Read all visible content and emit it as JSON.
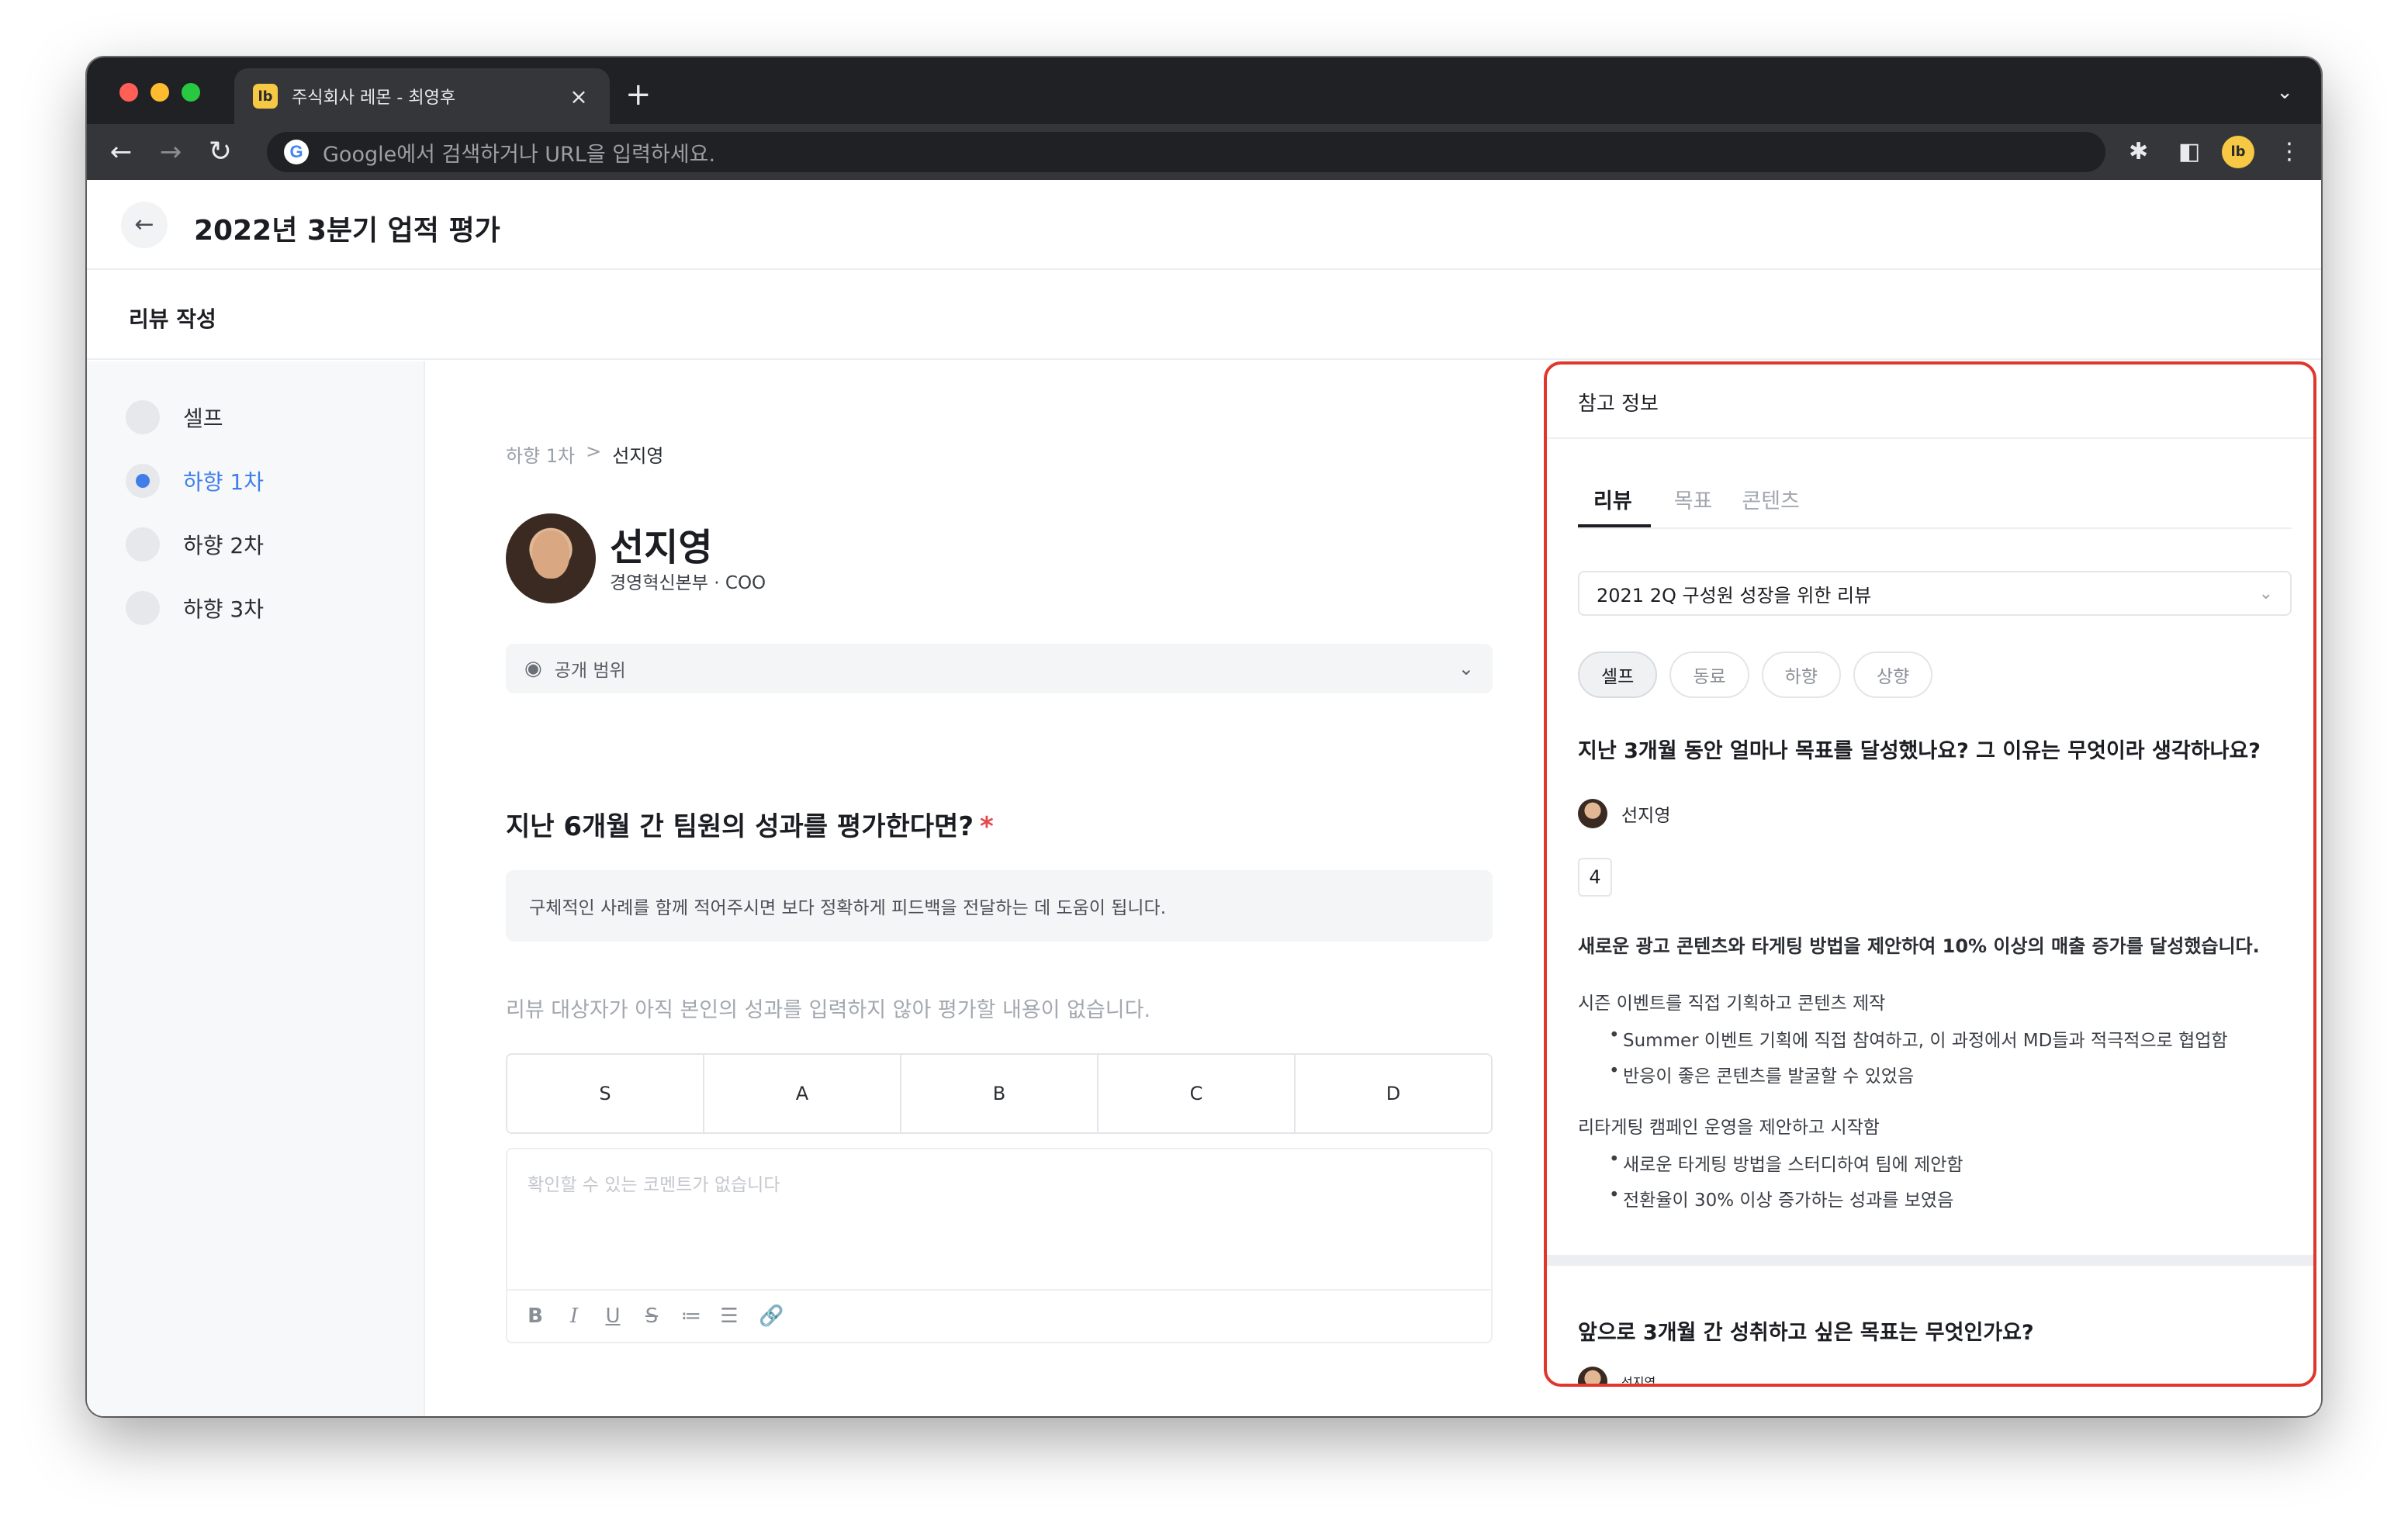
{
  "browser": {
    "tab_title": "주식회사 레몬 - 최영후",
    "tab_favicon": "lb",
    "profile_initials": "lb",
    "omnibox_placeholder": "Google에서 검색하거나 URL을 입력하세요.",
    "new_tab": "+",
    "close": "×"
  },
  "header": {
    "title": "2022년 3분기 업적 평가",
    "subtitle": "리뷰 작성"
  },
  "sidebar": {
    "steps": [
      {
        "label": "셀프"
      },
      {
        "label": "하향 1차"
      },
      {
        "label": "하향 2차"
      },
      {
        "label": "하향 3차"
      }
    ],
    "active_index": 1
  },
  "main": {
    "breadcrumb": {
      "parent": "하향 1차",
      "separator": ">",
      "current": "선지영"
    },
    "person": {
      "name": "선지영",
      "role": "경영혁신본부 · COO"
    },
    "scope_label": "공개 범위",
    "question": "지난 6개월 간 팀원의 성과를 평가한다면?",
    "required_mark": "*",
    "hint": "구체적인 사례를 함께 적어주시면 보다 정확하게 피드백을 전달하는 데 도움이 됩니다.",
    "empty_notice": "리뷰 대상자가 아직 본인의 성과를 입력하지 않아 평가할 내용이 없습니다.",
    "grades": [
      "S",
      "A",
      "B",
      "C",
      "D"
    ],
    "comment_placeholder": "확인할 수 있는 코멘트가 없습니다"
  },
  "panel": {
    "title": "참고 정보",
    "tabs": [
      "리뷰",
      "목표",
      "콘텐츠"
    ],
    "active_tab": 0,
    "select_value": "2021 2Q 구성원 성장을 위한 리뷰",
    "chips": [
      "셀프",
      "동료",
      "하향",
      "상향"
    ],
    "active_chip": 0,
    "question1": "지난 3개월 동안 얼마나 목표를 달성했나요? 그 이유는 무엇이라 생각하나요?",
    "author": "선지영",
    "score": "4",
    "answer_lead": "새로운 광고 콘텐츠와 타게팅 방법을 제안하여 10% 이상의 매출 증가를 달성했습니다.",
    "group1": {
      "heading": "시즌 이벤트를 직접 기획하고 콘텐츠 제작",
      "items": [
        "Summer 이벤트 기획에 직접 참여하고, 이 과정에서 MD들과 적극적으로 협업함",
        "반응이 좋은 콘텐츠를 발굴할 수 있었음"
      ]
    },
    "group2": {
      "heading": "리타게팅 캠페인 운영을 제안하고 시작함",
      "items": [
        "새로운 타게팅 방법을 스터디하여 팀에 제안함",
        "전환율이 30% 이상 증가하는 성과를 보였음"
      ]
    },
    "question2": "앞으로 3개월 간 성취하고 싶은 목표는 무엇인가요?",
    "author2": "선지영"
  },
  "colors": {
    "accent": "#3f7ee8",
    "highlight_border": "#e0362c",
    "required": "#e5484d"
  }
}
